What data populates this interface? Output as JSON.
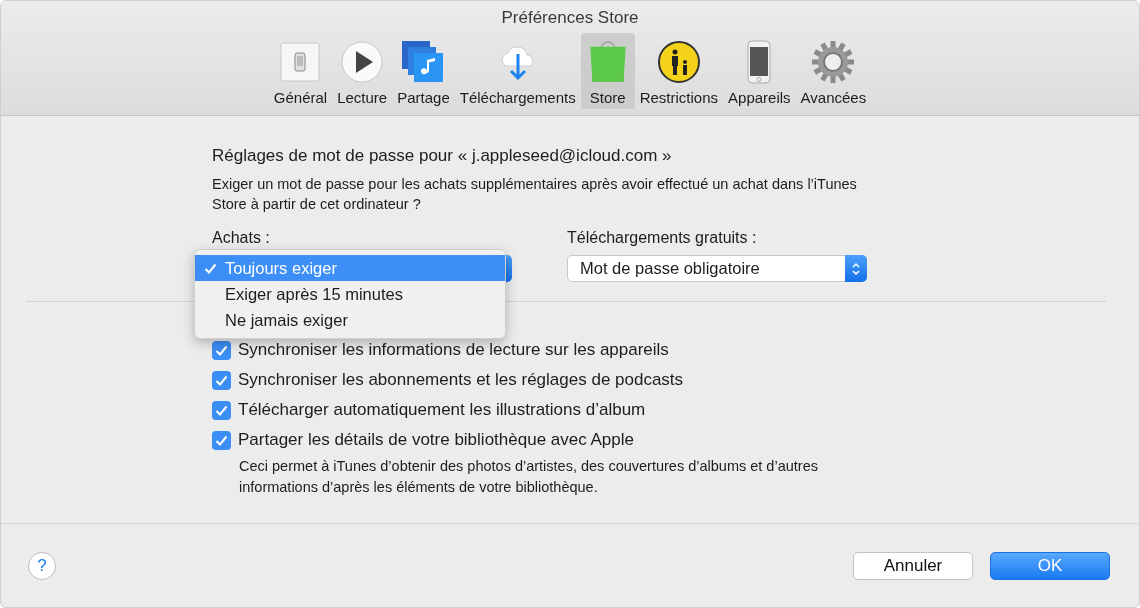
{
  "window": {
    "title": "Préférences Store"
  },
  "toolbar": [
    {
      "label": "Général",
      "kind": "general",
      "selected": false
    },
    {
      "label": "Lecture",
      "kind": "playback",
      "selected": false
    },
    {
      "label": "Partage",
      "kind": "sharing",
      "selected": false
    },
    {
      "label": "Téléchargements",
      "kind": "downloads",
      "selected": false
    },
    {
      "label": "Store",
      "kind": "store",
      "selected": true
    },
    {
      "label": "Restrictions",
      "kind": "restrictions",
      "selected": false
    },
    {
      "label": "Appareils",
      "kind": "devices",
      "selected": false
    },
    {
      "label": "Avancées",
      "kind": "advanced",
      "selected": false
    }
  ],
  "password": {
    "heading": "Réglages de mot de passe pour « j.appleseed@icloud.com »",
    "question": "Exiger un mot de passe pour les achats supplémentaires après avoir effectué un achat dans l’iTunes Store à partir de cet ordinateur ?",
    "purchases": {
      "label": "Achats :",
      "options": [
        {
          "label": "Toujours exiger",
          "selected": true
        },
        {
          "label": "Exiger après 15 minutes",
          "selected": false
        },
        {
          "label": "Ne jamais exiger",
          "selected": false
        }
      ]
    },
    "free_downloads": {
      "label": "Téléchargements gratuits :",
      "value": "Mot de passe obligatoire"
    }
  },
  "checkboxes": [
    {
      "label": "Synchroniser les informations de lecture sur les appareils",
      "checked": true
    },
    {
      "label": "Synchroniser les abonnements et les réglages de podcasts",
      "checked": true
    },
    {
      "label": "Télécharger automatiquement les illustrations d’album",
      "checked": true
    },
    {
      "label": "Partager les détails de votre bibliothèque avec Apple",
      "checked": true,
      "note": "Ceci permet à iTunes d’obtenir des photos d’artistes, des couvertures d’albums et d’autres informations d’après les éléments de votre bibliothèque."
    }
  ],
  "help": "?",
  "buttons": [
    {
      "label": "Annuler",
      "kind": "cancel"
    },
    {
      "label": "OK",
      "kind": "default"
    }
  ]
}
